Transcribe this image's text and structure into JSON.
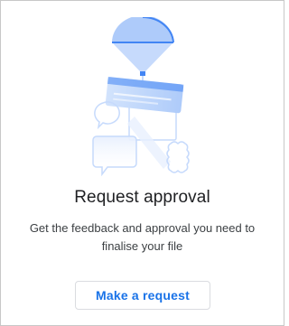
{
  "dialog": {
    "title": "Request approval",
    "description": "Get the feedback and approval you need to finalise your file",
    "primary_button_label": "Make a request"
  },
  "colors": {
    "accent_blue": "#1a73e8",
    "illustration_blue": "#4285f4",
    "light_blue": "#aecbfa",
    "outline_blue": "#c6dafc",
    "title_text": "#202124",
    "body_text": "#3c4043",
    "panel_border": "#c8c8c8"
  },
  "icons": {
    "illustration": "approval-balloon-illustration-icon"
  }
}
